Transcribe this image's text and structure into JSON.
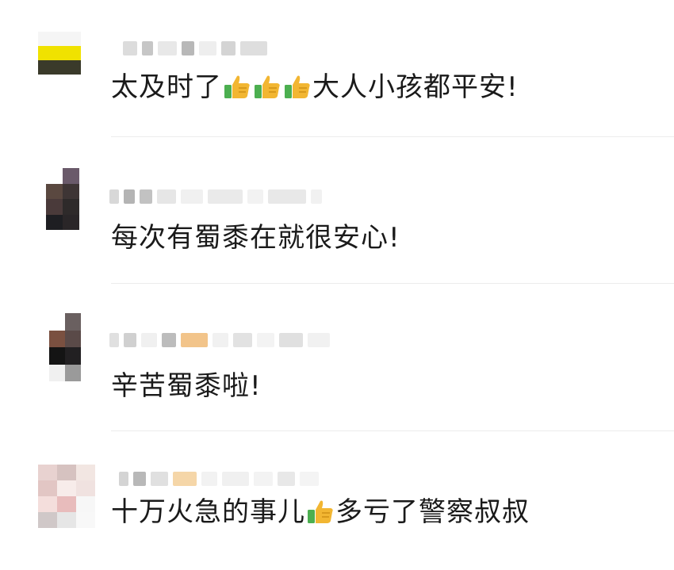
{
  "comments": [
    {
      "text_before": "太及时了",
      "thumbs": 3,
      "text_after": "大人小孩都平安!"
    },
    {
      "text_before": "每次有蜀黍在就很安心!",
      "thumbs": 0,
      "text_after": ""
    },
    {
      "text_before": "辛苦蜀黍啦!",
      "thumbs": 0,
      "text_after": ""
    },
    {
      "text_before": "十万火急的事儿",
      "thumbs": 1,
      "text_after": "多亏了警察叔叔"
    }
  ],
  "icons": {
    "thumb": "thumbs-up-icon"
  },
  "colors": {
    "text": "#1a1a1a",
    "divider": "#ececec",
    "thumb_yellow": "#f2b632",
    "thumb_green": "#4caf50"
  }
}
